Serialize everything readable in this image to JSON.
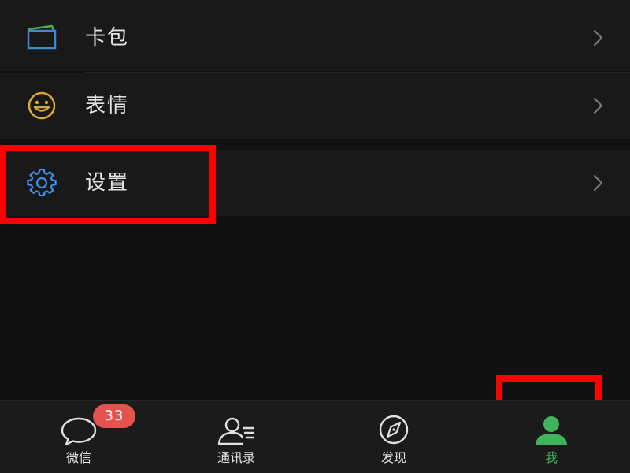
{
  "menu": {
    "items": [
      {
        "label": "卡包",
        "icon": "card-wallet-icon"
      },
      {
        "label": "表情",
        "icon": "smiley-icon"
      },
      {
        "label": "设置",
        "icon": "gear-icon"
      }
    ]
  },
  "tabbar": {
    "tabs": [
      {
        "label": "微信",
        "icon": "chat-bubble-icon",
        "badge": "33"
      },
      {
        "label": "通讯录",
        "icon": "contacts-icon"
      },
      {
        "label": "发现",
        "icon": "compass-icon"
      },
      {
        "label": "我",
        "icon": "person-icon",
        "active": true
      }
    ]
  },
  "colors": {
    "background": "#111111",
    "row_background": "#191919",
    "accent_green": "#3fb45c",
    "badge_red": "#e6534f",
    "highlight_red": "#ff0000",
    "card_icon_blue": "#3f88d6",
    "card_icon_green": "#4caf50",
    "smiley_yellow": "#d8a93a",
    "gear_blue": "#3f8ee8"
  }
}
